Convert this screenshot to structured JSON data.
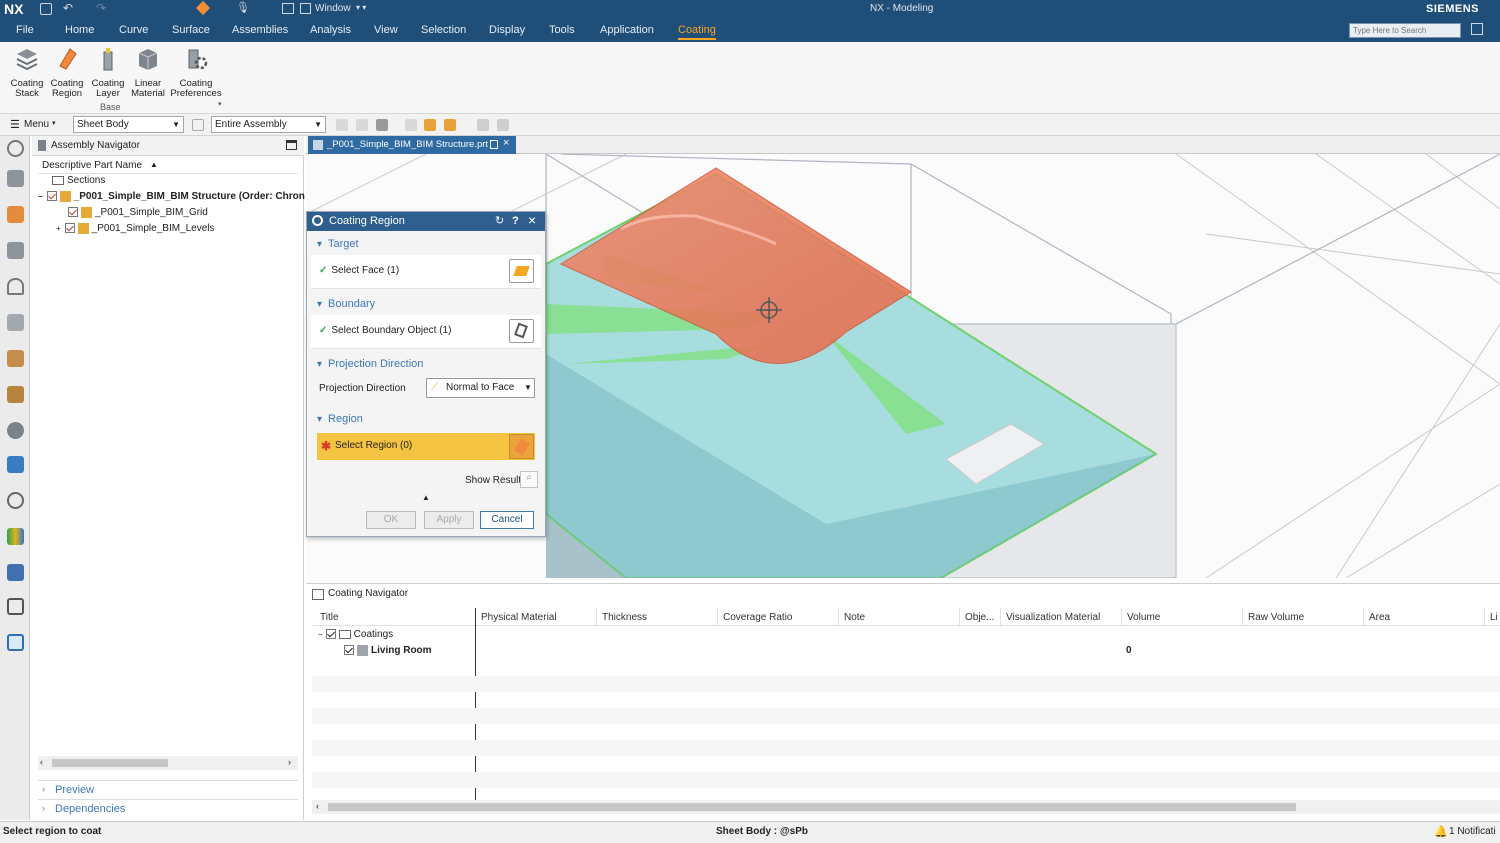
{
  "titlebar": {
    "brand": "NX",
    "window_menu": "Window",
    "title": "NX - Modeling",
    "vendor": "SIEMENS"
  },
  "menubar": {
    "items": [
      "File",
      "Home",
      "Curve",
      "Surface",
      "Assemblies",
      "Analysis",
      "View",
      "Selection",
      "Display",
      "Tools",
      "Application",
      "Coating"
    ],
    "active": "Coating",
    "search_placeholder": "Type Here to Search"
  },
  "ribbon": {
    "buttons": [
      {
        "label1": "Coating",
        "label2": "Stack",
        "icon": "coating-stack-icon"
      },
      {
        "label1": "Coating",
        "label2": "Region",
        "icon": "coating-region-icon"
      },
      {
        "label1": "Coating",
        "label2": "Layer",
        "icon": "coating-layer-icon"
      },
      {
        "label1": "Linear",
        "label2": "Material",
        "icon": "linear-material-icon"
      },
      {
        "label1": "Coating",
        "label2": "Preferences",
        "icon": "coating-preferences-icon"
      }
    ],
    "group": "Base"
  },
  "toolbar": {
    "menu_label": "Menu",
    "filter": "Sheet Body",
    "scope": "Entire Assembly"
  },
  "assembly_nav": {
    "title": "Assembly Navigator",
    "column": "Descriptive Part Name",
    "rows": [
      {
        "label": "Sections"
      },
      {
        "label": "_P001_Simple_BIM_BIM Structure (Order: Chron"
      },
      {
        "label": "_P001_Simple_BIM_Grid"
      },
      {
        "label": "_P001_Simple_BIM_Levels"
      }
    ],
    "preview": "Preview",
    "dependencies": "Dependencies"
  },
  "viewport": {
    "tab_label": "_P001_Simple_BIM_BIM Structure.prt"
  },
  "dialog": {
    "title": "Coating Region",
    "sections": {
      "target": "Target",
      "select_face": "Select Face (1)",
      "boundary": "Boundary",
      "select_boundary": "Select Boundary Object (1)",
      "projection": "Projection Direction",
      "projection_label": "Projection Direction",
      "projection_value": "Normal to Face",
      "region": "Region",
      "select_region": "Select Region (0)",
      "show_result": "Show Result"
    },
    "buttons": {
      "ok": "OK",
      "apply": "Apply",
      "cancel": "Cancel"
    }
  },
  "coating_nav": {
    "title": "Coating Navigator",
    "columns": [
      "Title",
      "Physical Material",
      "Thickness",
      "Coverage Ratio",
      "Note",
      "Obje...",
      "Visualization Material",
      "Volume",
      "Raw Volume",
      "Area",
      "Li"
    ],
    "rows": [
      {
        "title": "Coatings",
        "volume": ""
      },
      {
        "title": "Living Room",
        "volume": "0"
      }
    ]
  },
  "status": {
    "left": "Select region to coat",
    "center": "Sheet Body : @sPb",
    "right": "1 Notificati"
  },
  "colors": {
    "accent_orange": "#f5a623",
    "nx_blue": "#1f4e79",
    "region_orange": "#e8613f",
    "region_green": "#6fe06a",
    "face_cyan": "#a8dde0"
  }
}
